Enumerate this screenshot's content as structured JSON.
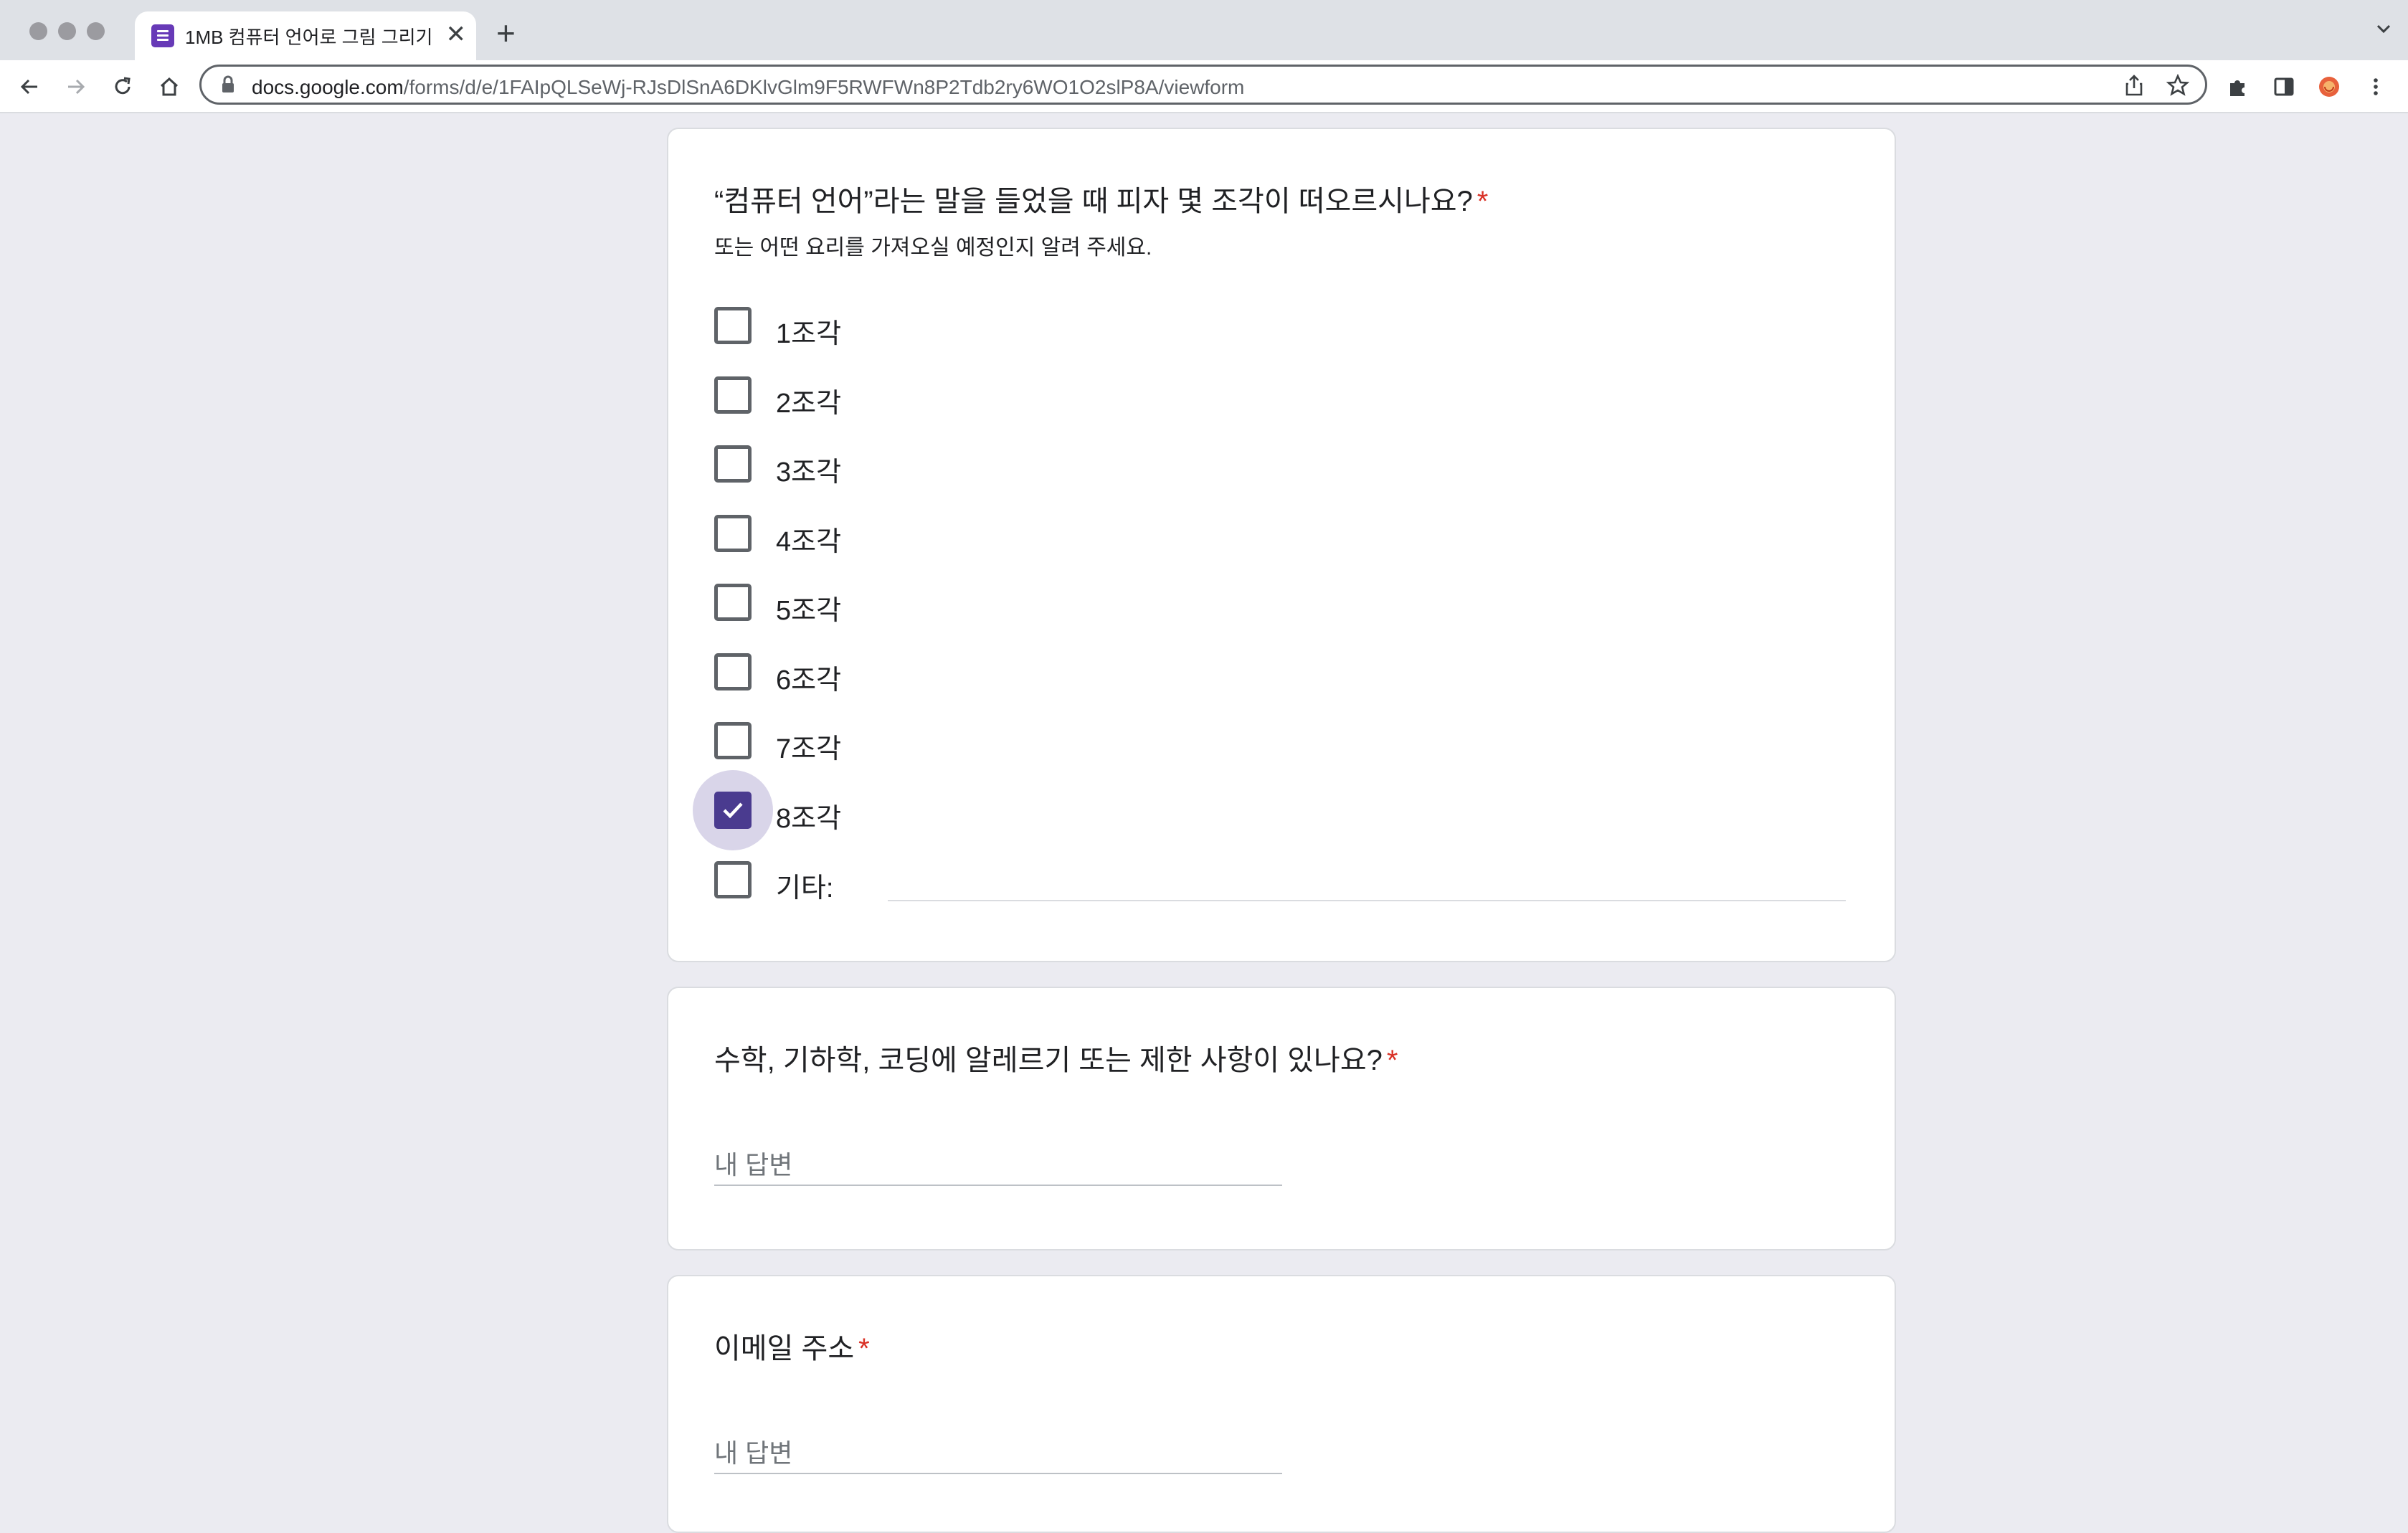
{
  "browser": {
    "tab_title": "1MB 컴퓨터 언어로 그림 그리기",
    "tab_close": "✕",
    "new_tab": "+",
    "url_host": "docs.google.com",
    "url_path": "/forms/d/e/1FAIpQLSeWj-RJsDlSnA6DKlvGlm9F5RWFWn8P2Tdb2ry6WO1O2slP8A/viewform",
    "brand_color": "#673ab7"
  },
  "form": {
    "accent_color": "#4a3b8f",
    "required_marker": "*",
    "pizza_question": {
      "title": "“컴퓨터 언어”라는 말을 들었을 때 피자 몇 조각이 떠오르시나요?",
      "description": "또는 어떤 요리를 가져오실 예정인지 알려 주세요.",
      "options": [
        {
          "label": "1조각",
          "checked": false
        },
        {
          "label": "2조각",
          "checked": false
        },
        {
          "label": "3조각",
          "checked": false
        },
        {
          "label": "4조각",
          "checked": false
        },
        {
          "label": "5조각",
          "checked": false
        },
        {
          "label": "6조각",
          "checked": false
        },
        {
          "label": "7조각",
          "checked": false
        },
        {
          "label": "8조각",
          "checked": true
        }
      ],
      "other_label": "기타:"
    },
    "allergy_question": {
      "title": "수학, 기하학, 코딩에 알레르기 또는 제한 사항이 있나요?",
      "placeholder": "내 답변"
    },
    "email_question": {
      "title": "이메일 주소",
      "placeholder": "내 답변"
    }
  }
}
